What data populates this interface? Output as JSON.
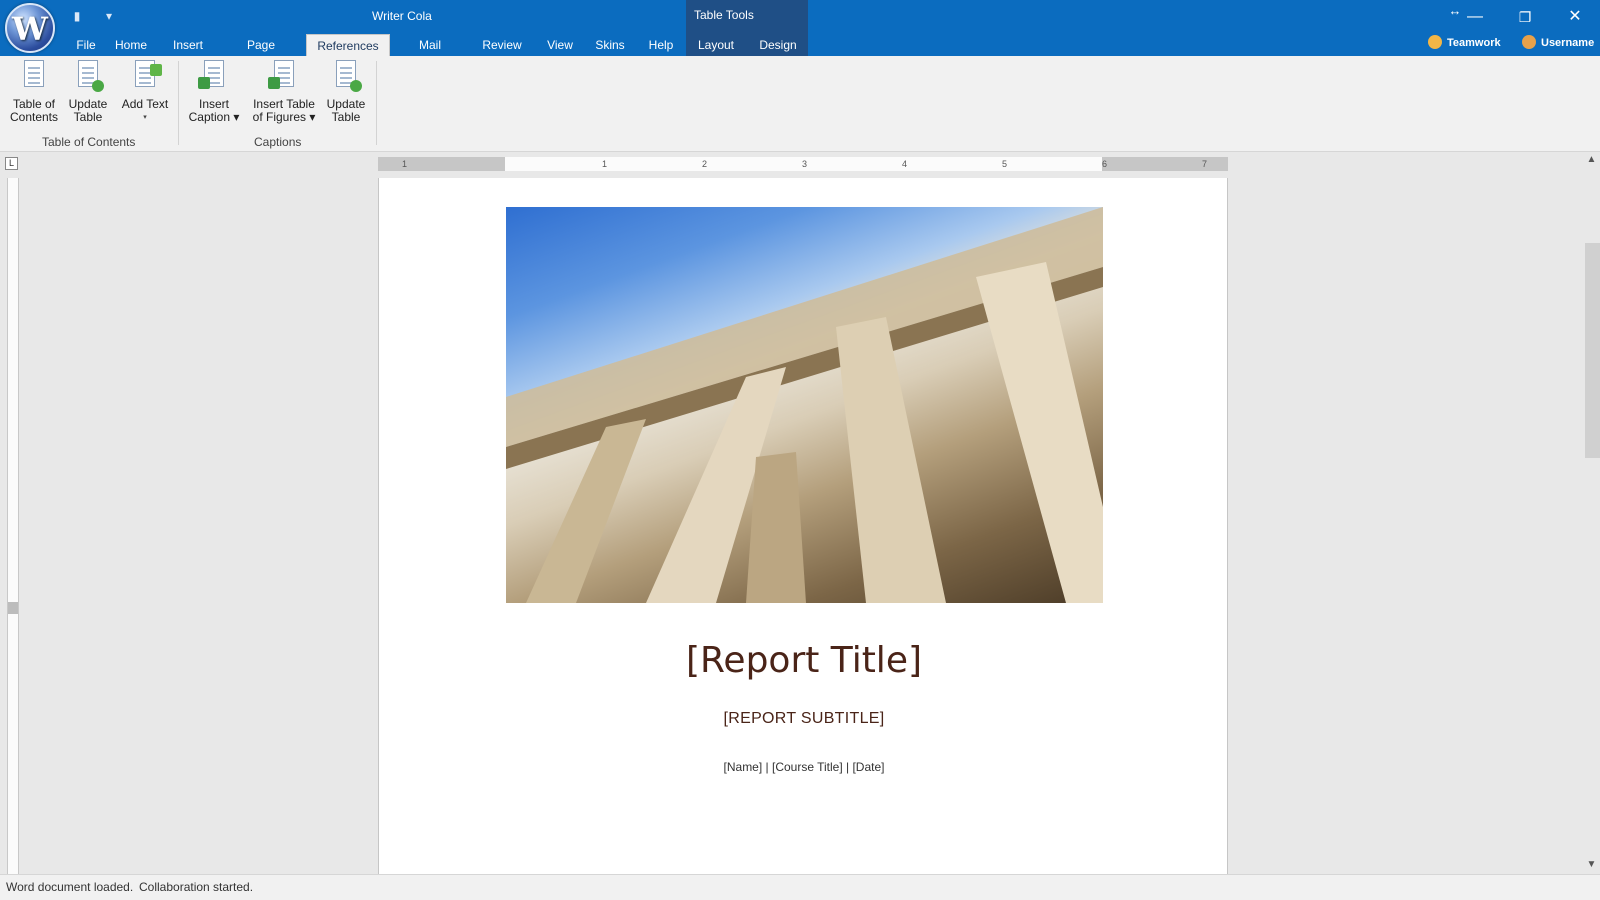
{
  "window": {
    "title": "Writer Cola",
    "logo_letter": "W",
    "context_tab_group": "Table Tools"
  },
  "tabs": [
    {
      "label": "File"
    },
    {
      "label": "Home"
    },
    {
      "label": "Insert"
    },
    {
      "label": "Page Layout"
    },
    {
      "label": "References",
      "active": true
    },
    {
      "label": "Mail Merge"
    },
    {
      "label": "Review"
    },
    {
      "label": "View"
    },
    {
      "label": "Skins"
    },
    {
      "label": "Help"
    },
    {
      "label": "Layout"
    },
    {
      "label": "Design"
    }
  ],
  "user": {
    "teamwork": "Teamwork",
    "username": "Username"
  },
  "ribbon": {
    "toc_group": {
      "label": "Table of Contents",
      "buttons": [
        {
          "line1": "Table of",
          "line2": "Contents"
        },
        {
          "line1": "Update",
          "line2": "Table"
        },
        {
          "line1": "Add Text",
          "line2": "▾"
        }
      ]
    },
    "captions_group": {
      "label": "Captions",
      "buttons": [
        {
          "line1": "Insert",
          "line2": "Caption ▾"
        },
        {
          "line1": "Insert Table",
          "line2": "of Figures ▾"
        },
        {
          "line1": "Update",
          "line2": "Table"
        }
      ]
    }
  },
  "ruler": {
    "numbers": [
      "1",
      "1",
      "2",
      "3",
      "4",
      "5",
      "6",
      "7"
    ]
  },
  "document": {
    "title": "[Report Title]",
    "subtitle": "[REPORT SUBTITLE]",
    "meta": "[Name] | [Course Title] | [Date]"
  },
  "status": {
    "left": "Word document loaded.",
    "right": "Collaboration started."
  }
}
